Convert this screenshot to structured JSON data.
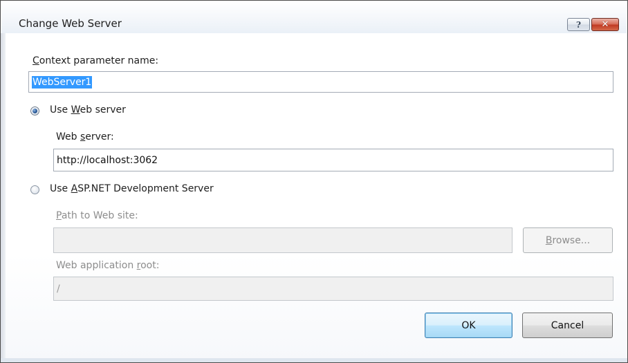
{
  "window": {
    "title": "Change Web Server",
    "help_glyph": "?",
    "close_glyph": "✕"
  },
  "form": {
    "context_label_prefix": "",
    "context_label_access": "C",
    "context_label_rest": "ontext parameter name:",
    "context_value": "WebServer1",
    "use_web_server_radio": {
      "prefix": "Use ",
      "access": "W",
      "rest": "eb server",
      "checked": true
    },
    "web_server_label_prefix": "Web ",
    "web_server_label_access": "s",
    "web_server_label_rest": "erver:",
    "web_server_value": "http://localhost:3062",
    "use_dev_server_radio": {
      "prefix": "Use ",
      "access": "A",
      "rest": "SP.NET Development Server",
      "checked": false
    },
    "path_label_prefix": "",
    "path_label_access": "P",
    "path_label_rest": "ath to Web site:",
    "path_value": "",
    "browse_prefix": "",
    "browse_access": "B",
    "browse_rest": "rowse...",
    "root_label_prefix": "Web application ",
    "root_label_access": "r",
    "root_label_rest": "oot:",
    "root_value": "/"
  },
  "buttons": {
    "ok_label": "OK",
    "cancel_label": "Cancel"
  }
}
